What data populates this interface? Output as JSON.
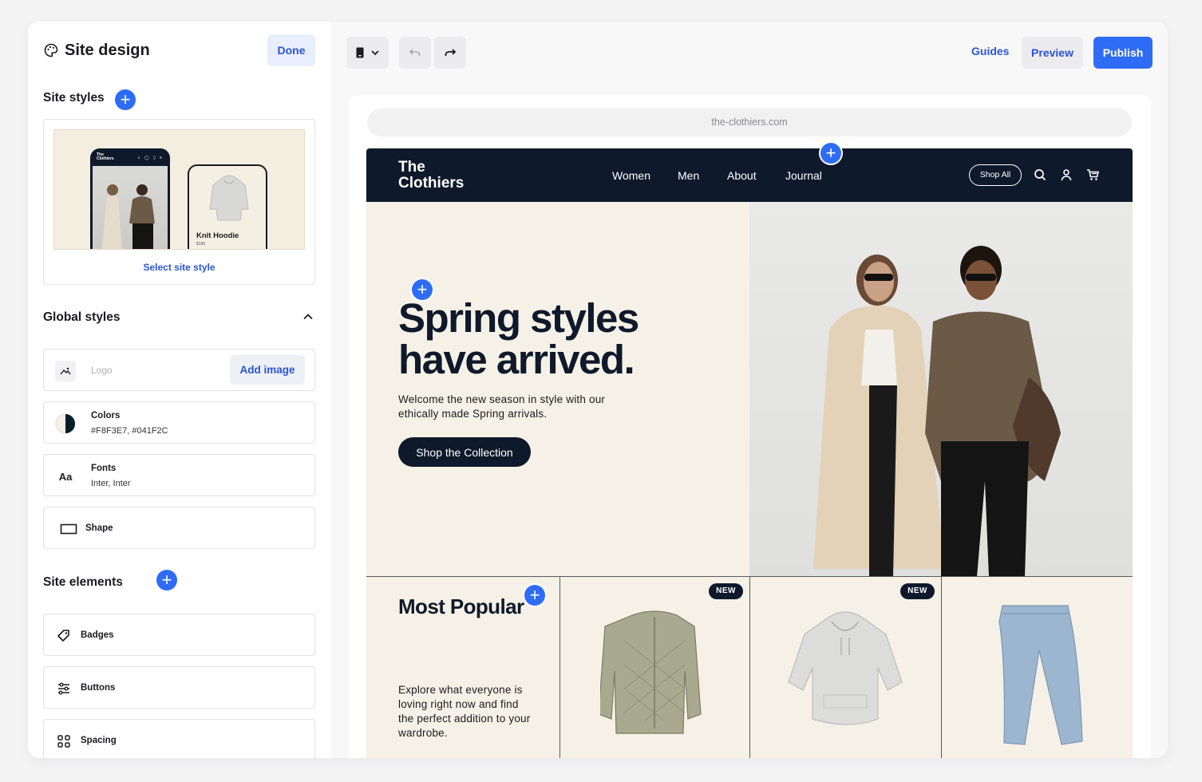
{
  "sidebar": {
    "title": "Site design",
    "done_label": "Done",
    "site_styles": {
      "title": "Site styles",
      "preview": {
        "phone_brand_line1": "The",
        "phone_brand_line2": "Clothiers",
        "product_name": "Knit Hoodie",
        "product_price": "$190"
      },
      "select_label": "Select site style"
    },
    "global_styles": {
      "title": "Global styles",
      "logo": {
        "placeholder": "Logo",
        "add_image_label": "Add image"
      },
      "colors": {
        "label": "Colors",
        "value": "#F8F3E7, #041F2C"
      },
      "fonts": {
        "label": "Fonts",
        "value": "Inter, Inter",
        "icon_text": "Aa"
      },
      "shape": {
        "label": "Shape"
      }
    },
    "site_elements": {
      "title": "Site elements",
      "items": [
        {
          "label": "Badges",
          "icon": "tag-icon"
        },
        {
          "label": "Buttons",
          "icon": "sliders-icon"
        },
        {
          "label": "Spacing",
          "icon": "grid-icon"
        }
      ]
    }
  },
  "toolbar": {
    "guides_label": "Guides",
    "preview_label": "Preview",
    "publish_label": "Publish"
  },
  "canvas": {
    "url": "the-clothiers.com",
    "site": {
      "brand_line1": "The",
      "brand_line2": "Clothiers",
      "nav": [
        "Women",
        "Men",
        "About",
        "Journal"
      ],
      "shop_all_label": "Shop All",
      "hero": {
        "title_line1": "Spring styles",
        "title_line2": "have arrived.",
        "subtitle": "Welcome the new season in style with our ethically made Spring arrivals.",
        "cta_label": "Shop the Collection"
      },
      "most_popular": {
        "title": "Most Popular",
        "description": "Explore what everyone is loving right now and find the perfect addition to your wardrobe."
      },
      "badge_label": "NEW"
    }
  },
  "colors": {
    "accent": "#2F6CF5",
    "brand_dark": "#0E1A2B",
    "brand_cream": "#F5F1E6"
  }
}
